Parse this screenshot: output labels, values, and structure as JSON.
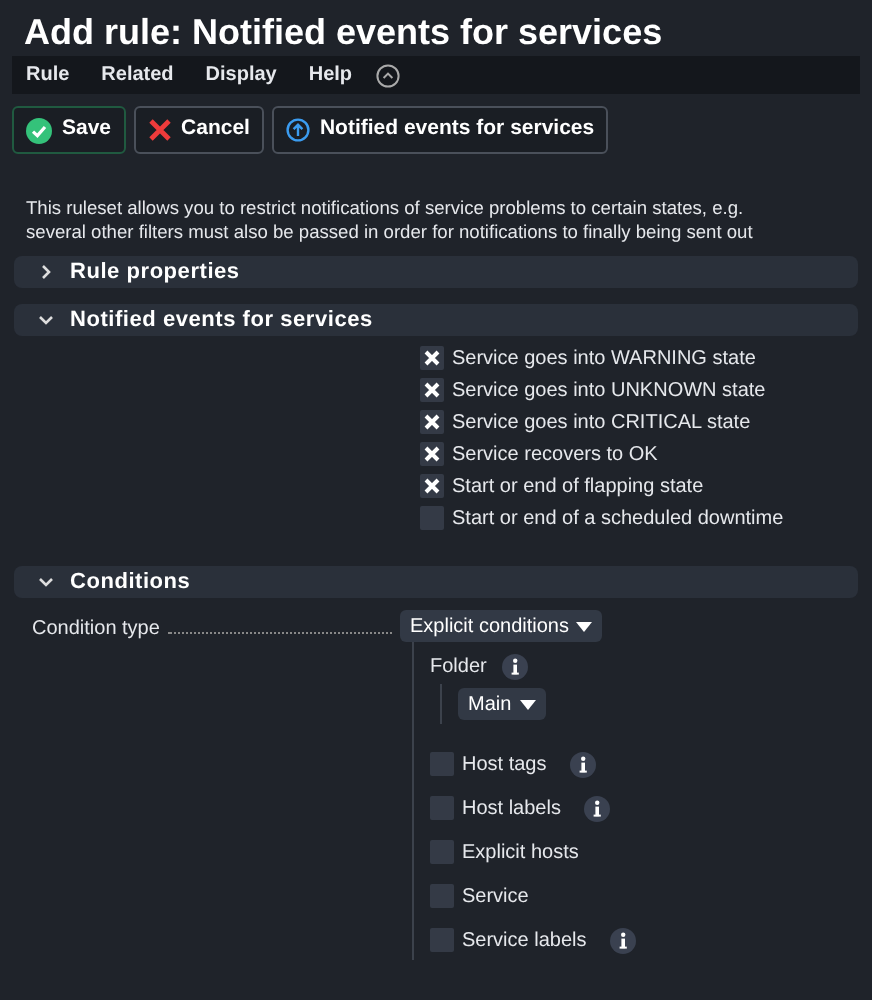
{
  "title": "Add rule: Notified events for services",
  "menu": [
    "Rule",
    "Related",
    "Display",
    "Help"
  ],
  "buttons": [
    {
      "kind": "save",
      "label": "Save"
    },
    {
      "kind": "cancel",
      "label": "Cancel"
    },
    {
      "kind": "up",
      "label": "Notified events for services"
    }
  ],
  "description": [
    "This ruleset allows you to restrict notifications of service problems to certain states, e.g.",
    "several other filters must also be passed in order for notifications to finally being sent out"
  ],
  "sections": [
    {
      "title": "Rule properties",
      "expanded": false
    },
    {
      "title": "Notified events for services",
      "expanded": true,
      "events": [
        {
          "label": "Service goes into WARNING state",
          "checked": true
        },
        {
          "label": "Service goes into UNKNOWN state",
          "checked": true
        },
        {
          "label": "Service goes into CRITICAL state",
          "checked": true
        },
        {
          "label": "Service recovers to OK",
          "checked": true
        },
        {
          "label": "Start or end of flapping state",
          "checked": true
        },
        {
          "label": "Start or end of a scheduled downtime",
          "checked": false
        }
      ]
    },
    {
      "title": "Conditions",
      "expanded": true,
      "condition_type": {
        "label": "Condition type",
        "value": "Explicit conditions"
      },
      "folder": {
        "label": "Folder",
        "value": "Main"
      },
      "options": [
        {
          "label": "Host tags",
          "checked": false,
          "info": true
        },
        {
          "label": "Host labels",
          "checked": false,
          "info": true
        },
        {
          "label": "Explicit hosts",
          "checked": false,
          "info": false
        },
        {
          "label": "Service",
          "checked": false,
          "info": false
        },
        {
          "label": "Service labels",
          "checked": false,
          "info": true
        }
      ]
    }
  ]
}
